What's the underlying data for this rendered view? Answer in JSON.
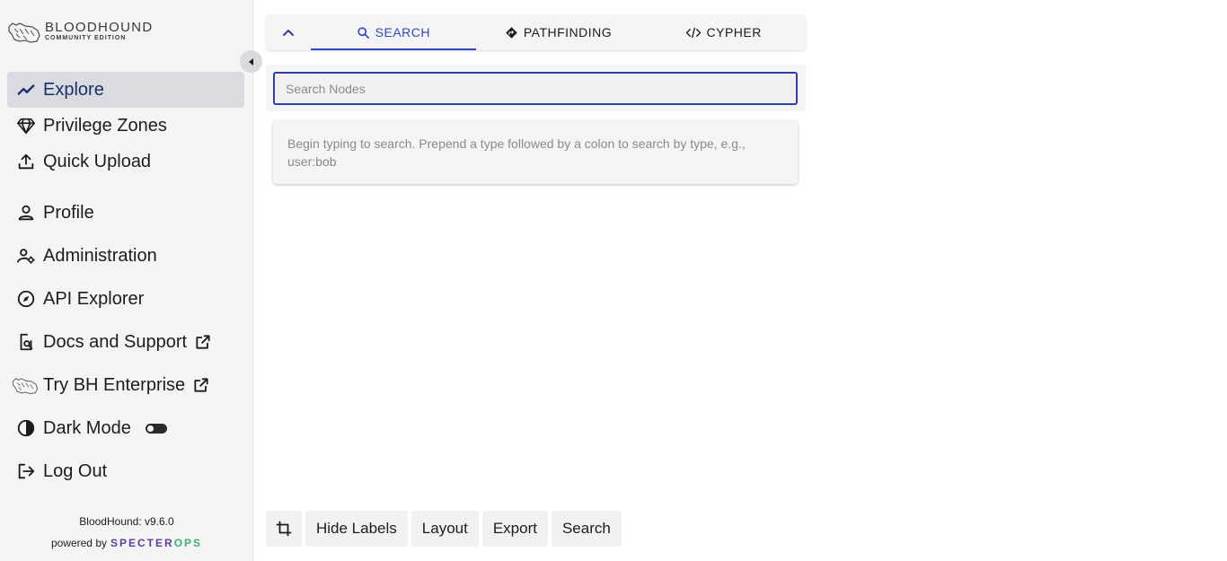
{
  "brand": {
    "title": "BLOODHOUND",
    "subtitle": "COMMUNITY EDITION"
  },
  "sidebar": {
    "items": [
      {
        "label": "Explore",
        "icon": "trend-line-icon",
        "active": true
      },
      {
        "label": "Privilege Zones",
        "icon": "gem-icon"
      },
      {
        "label": "Quick Upload",
        "icon": "upload-icon"
      },
      {
        "label": "Profile",
        "icon": "user-icon"
      },
      {
        "label": "Administration",
        "icon": "user-gear-icon"
      },
      {
        "label": "API Explorer",
        "icon": "compass-icon"
      },
      {
        "label": "Docs and Support",
        "icon": "doc-search-icon",
        "external": true
      },
      {
        "label": "Try BH Enterprise",
        "icon": "bloodhound-dog-icon",
        "external": true
      },
      {
        "label": "Dark Mode",
        "icon": "half-circle-icon",
        "toggle": false
      },
      {
        "label": "Log Out",
        "icon": "logout-icon"
      }
    ],
    "version": "BloodHound: v9.6.0",
    "powered_by": "powered by",
    "vendor_a": "SPECTER",
    "vendor_b": "OPS"
  },
  "tabs": [
    {
      "label": "SEARCH",
      "icon": "search-icon",
      "active": true
    },
    {
      "label": "PATHFINDING",
      "icon": "diamond-route-icon"
    },
    {
      "label": "CYPHER",
      "icon": "code-icon"
    }
  ],
  "search": {
    "placeholder": "Search Nodes",
    "hint": "Begin typing to search. Prepend a type followed by a colon to search by type, e.g., user:bob"
  },
  "toolbar": {
    "hide_labels": "Hide Labels",
    "layout": "Layout",
    "export": "Export",
    "search": "Search"
  },
  "colors": {
    "accent": "#3148c4",
    "sidebar_bg": "#f4f4f4",
    "active_item_bg": "#d9dbe0"
  }
}
